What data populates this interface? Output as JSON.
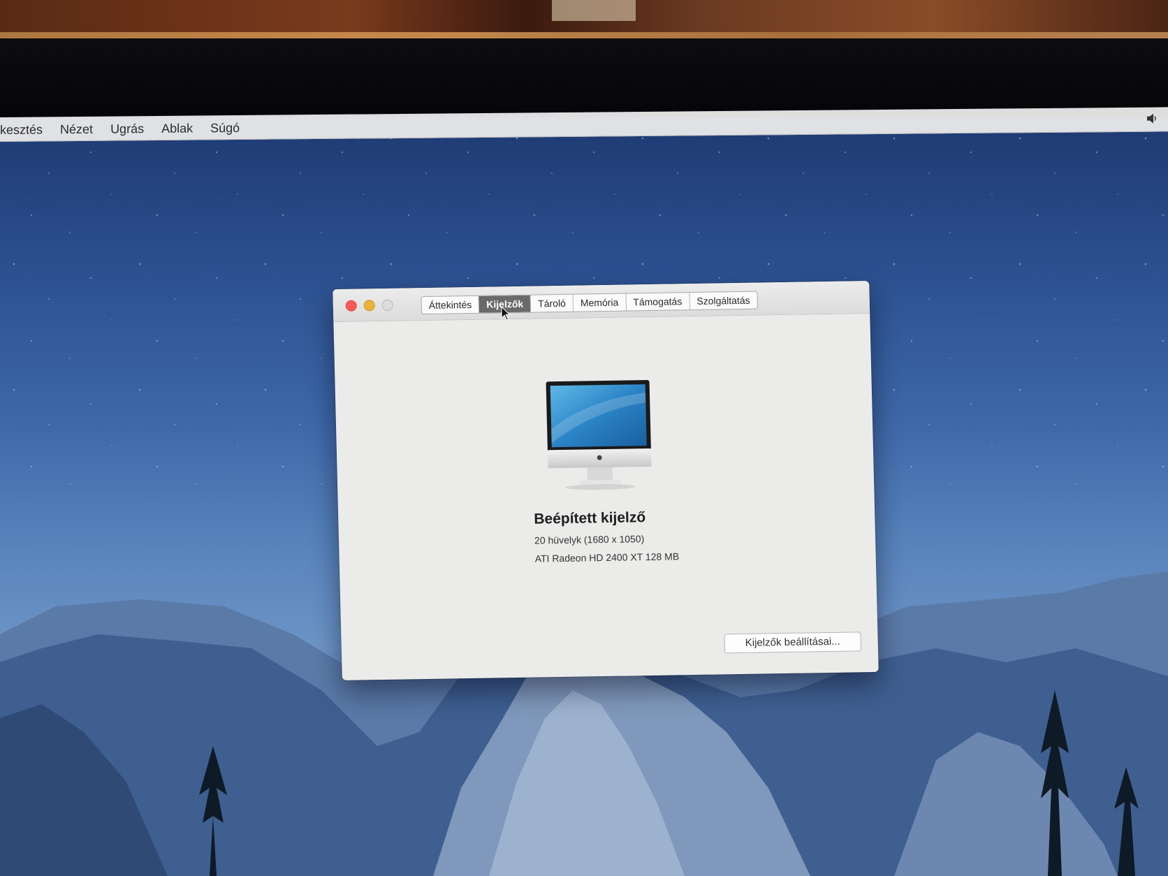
{
  "menubar": {
    "items": [
      "rkesztés",
      "Nézet",
      "Ugrás",
      "Ablak",
      "Súgó"
    ],
    "volume_icon": "speaker-icon"
  },
  "window": {
    "tabs": [
      {
        "label": "Áttekintés",
        "active": false
      },
      {
        "label": "Kijelzők",
        "active": true
      },
      {
        "label": "Tároló",
        "active": false
      },
      {
        "label": "Memória",
        "active": false
      },
      {
        "label": "Támogatás",
        "active": false
      },
      {
        "label": "Szolgáltatás",
        "active": false
      }
    ],
    "display": {
      "name": "Beépített kijelző",
      "size": "20 hüvelyk (1680 x 1050)",
      "gpu": "ATI Radeon HD 2400 XT 128 MB"
    },
    "settings_button": "Kijelzők beállításai..."
  },
  "colors": {
    "close": "#fc5b57",
    "minimize": "#e8b43a",
    "active_tab": "#6a6a6a"
  }
}
